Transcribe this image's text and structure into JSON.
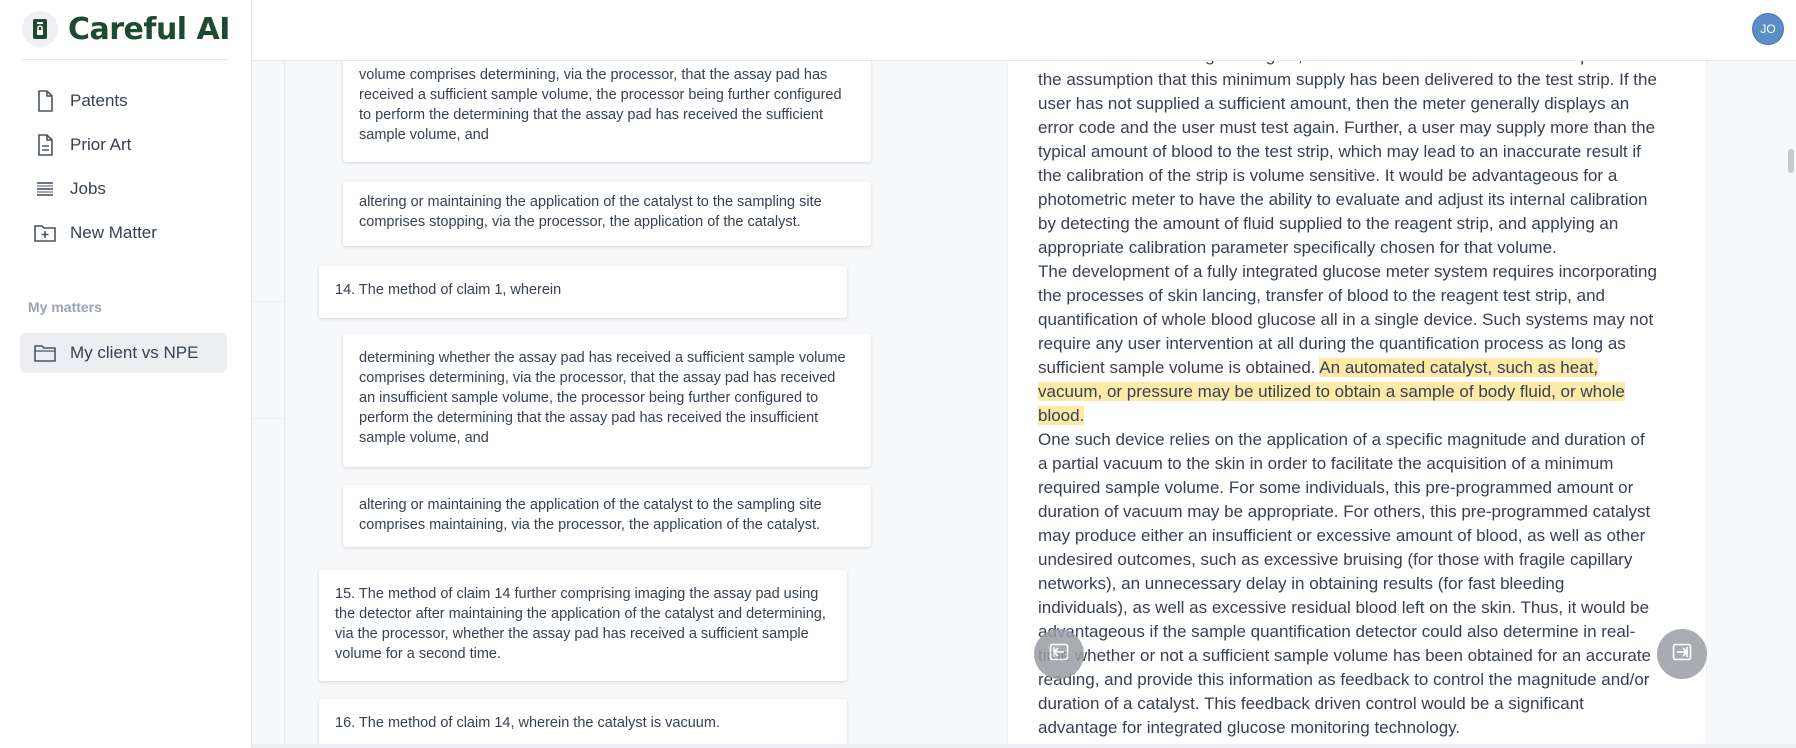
{
  "app": {
    "name": "Careful AI",
    "logo_icon": "document-lock-icon"
  },
  "sidebar": {
    "nav": [
      {
        "label": "Patents",
        "icon": "document-icon"
      },
      {
        "label": "Prior Art",
        "icon": "document-lines-icon"
      },
      {
        "label": "Jobs",
        "icon": "list-icon"
      },
      {
        "label": "New Matter",
        "icon": "folder-plus-icon"
      }
    ],
    "section_label": "My matters",
    "matters": [
      {
        "label": "My client vs NPE",
        "icon": "folder-icon",
        "active": true
      }
    ]
  },
  "topbar": {
    "avatar_initials": "JO"
  },
  "claims": {
    "card1": "volume comprises determining, via the processor, that the assay pad has received a sufficient sample volume, the processor being further configured to perform the determining that the assay pad has received the sufficient sample volume, and",
    "card2": "altering or maintaining the application of the catalyst to the sampling site comprises stopping, via the processor, the application of the catalyst.",
    "card3": "14. The method of claim 1, wherein",
    "card4": "determining whether the assay pad has received a sufficient sample volume comprises determining, via the processor, that the assay pad has received an insufficient sample volume, the processor being further configured to perform the determining that the assay pad has received the insufficient sample volume, and",
    "card5": "altering or maintaining the application of the catalyst to the sampling site comprises maintaining, via the processor, the application of the catalyst.",
    "card6": "15. The method of claim 14 further comprising imaging the assay pad using the detector after maintaining the application of the catalyst and determining, via the processor, whether the assay pad has received a sufficient sample volume for a second time.",
    "card7": "16. The method of claim 14, wherein the catalyst is vacuum."
  },
  "document": {
    "para1": "blood from their lancing site. Again, the calibration of the meter is developed with the assumption that this minimum supply has been delivered to the test strip. If the user has not supplied a sufficient amount, then the meter generally displays an error code and the user must test again. Further, a user may supply more than the typical amount of blood to the test strip, which may lead to an inaccurate result if the calibration of the strip is volume sensitive. It would be advantageous for a photometric meter to have the ability to evaluate and adjust its internal calibration by detecting the amount of fluid supplied to the reagent strip, and applying an appropriate calibration parameter specifically chosen for that volume.",
    "para2_pre": "The development of a fully integrated glucose meter system requires incorporating the processes of skin lancing, transfer of blood to the reagent test strip, and quantification of whole blood glucose all in a single device. Such systems may not require any user intervention at all during the quantification process as long as sufficient sample volume is obtained. ",
    "para2_highlight": "An automated catalyst, such as heat, vacuum, or pressure may be utilized to obtain a sample of body fluid, or whole blood.",
    "para3": "One such device relies on the application of a specific magnitude and duration of a partial vacuum to the skin in order to facilitate the acquisition of a minimum required sample volume. For some individuals, this pre-programmed amount or duration of vacuum may be appropriate. For others, this pre-programmed catalyst may produce either an insufficient or excessive amount of blood, as well as other undesired outcomes, such as excessive bruising (for those with fragile capillary networks), an unnecessary delay in obtaining results (for fast bleeding individuals), as well as excessive residual blood left on the skin. Thus, it would be advantageous if the sample quantification detector could also determine in real-time whether or not a sufficient sample volume has been obtained for an accurate reading, and provide this information as feedback to control the magnitude and/or duration of a catalyst. This feedback driven control would be a significant advantage for integrated glucose monitoring technology."
  },
  "colors": {
    "brand": "#1e4a33",
    "highlight": "#fde9a8",
    "avatar": "#5b8dc6"
  }
}
